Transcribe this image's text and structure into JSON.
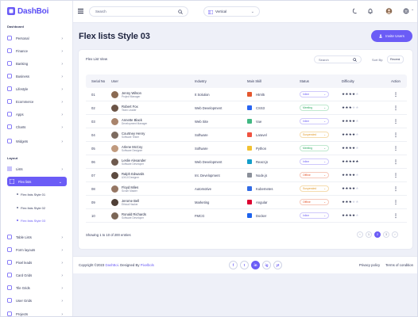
{
  "brand": {
    "name": "DashBoi",
    "accent": "#6b5cf6"
  },
  "topbar": {
    "search_placeholder": "Search",
    "layout_value": "Vertical"
  },
  "sidebar": {
    "section_dashboard": "Dashboard",
    "dashboard_items": [
      {
        "label": "Personal",
        "icon": "user-icon"
      },
      {
        "label": "Finance",
        "icon": "wallet-icon"
      },
      {
        "label": "Banking",
        "icon": "bank-icon"
      },
      {
        "label": "Business",
        "icon": "briefcase-icon"
      },
      {
        "label": "Lifestyle",
        "icon": "heart-icon"
      },
      {
        "label": "Ecommerce",
        "icon": "cart-icon"
      },
      {
        "label": "Apps",
        "icon": "grid-icon"
      },
      {
        "label": "Charts",
        "icon": "chart-icon"
      },
      {
        "label": "Widgets",
        "icon": "widget-icon"
      }
    ],
    "section_layout": "Layout",
    "layout_items": [
      {
        "label": "Lists"
      },
      {
        "label": "Flex lists"
      }
    ],
    "sub_items": [
      {
        "label": "Flex lists Style 01"
      },
      {
        "label": "Flex lists Style 02"
      },
      {
        "label": "Flex lists Style 03"
      }
    ],
    "more_items": [
      {
        "label": "Table Lists"
      },
      {
        "label": "Form layouts"
      },
      {
        "label": "Pixel leads"
      },
      {
        "label": "Card Grids"
      },
      {
        "label": "Tile Grids"
      },
      {
        "label": "User Grids"
      },
      {
        "label": "Projects"
      }
    ]
  },
  "page": {
    "title": "Flex lists Style 03",
    "invite_label": "Invite Users"
  },
  "card": {
    "title": "Flex List View",
    "search_placeholder": "Search",
    "sort_label": "Sort By:",
    "sort_value": "Recent"
  },
  "table": {
    "headers": [
      "Serial No",
      "User",
      "Industry",
      "Main Skill",
      "Status",
      "Difficulty",
      "Action"
    ],
    "rows": [
      {
        "sn": "01",
        "name": "Jenny Wilson",
        "role": "Project Manager",
        "industry": "It Solution",
        "skill": "Html5",
        "skill_color": "#e4572e",
        "status": "Inline",
        "diff": 4,
        "avatar": "#8a6a52"
      },
      {
        "sn": "02",
        "name": "Robert Fox",
        "role": "Team Leader",
        "industry": "Web Development",
        "skill": "CSS3",
        "skill_color": "#2965f1",
        "status": "Meeting",
        "diff": 3,
        "avatar": "#6b5446"
      },
      {
        "sn": "03",
        "name": "Annette Black",
        "role": "Development Manager",
        "industry": "Web Site",
        "skill": "Vue",
        "skill_color": "#41b883",
        "status": "Inline",
        "diff": 4,
        "avatar": "#a8836b"
      },
      {
        "sn": "04",
        "name": "Courtney Henry",
        "role": "Software Tester",
        "industry": "Software",
        "skill": "Laravel",
        "skill_color": "#f05340",
        "status": "Suspended",
        "diff": 4,
        "avatar": "#7d6b5f"
      },
      {
        "sn": "05",
        "name": "Arlene McCoy",
        "role": "Software Designer",
        "industry": "Software",
        "skill": "Python",
        "skill_color": "#f2c232",
        "status": "Meeting",
        "diff": 4,
        "avatar": "#c09a7e"
      },
      {
        "sn": "06",
        "name": "Leslie Alexander",
        "role": "Software Developer",
        "industry": "Web Development",
        "skill": "React.js",
        "skill_color": "#149eca",
        "status": "Inline",
        "diff": 5,
        "avatar": "#6e5a4e"
      },
      {
        "sn": "07",
        "name": "Ralph Edwards",
        "role": "UX/UI Designer",
        "industry": "Int. Development",
        "skill": "Node.js",
        "skill_color": "#8a8f99",
        "status": "Offline",
        "diff": 4,
        "avatar": "#5c4a3f"
      },
      {
        "sn": "08",
        "name": "Floyd Miles",
        "role": "Scrum Master",
        "industry": "Automotive",
        "skill": "Kubernetes",
        "skill_color": "#326ce5",
        "status": "Suspended",
        "diff": 4,
        "avatar": "#957663"
      },
      {
        "sn": "09",
        "name": "Jerome Bell",
        "role": "Ethical Hacker",
        "industry": "Marketing",
        "skill": "Angular",
        "skill_color": "#dd0031",
        "status": "Offline",
        "diff": 3,
        "avatar": "#4f3f36"
      },
      {
        "sn": "10",
        "name": "Ronald Richards",
        "role": "Software Developer",
        "industry": "FMCG",
        "skill": "Docker",
        "skill_color": "#1d63ed",
        "status": "Inline",
        "diff": 4,
        "avatar": "#7b6656"
      }
    ],
    "status_colors": {
      "Inline": {
        "fg": "#6b5cf6",
        "border": "#cfc9fb"
      },
      "Meeting": {
        "fg": "#2eaa62",
        "border": "#bfe8cf"
      },
      "Suspended": {
        "fg": "#e09a2b",
        "border": "#f5dcae"
      },
      "Offline": {
        "fg": "#e4572e",
        "border": "#f6c9bb"
      }
    },
    "showing_text": "Showing 1 to 10 of 200 entries",
    "pages": [
      "‹",
      "1",
      "2",
      "3",
      "›"
    ],
    "current_page": "2"
  },
  "footer": {
    "copyright_prefix": "Copyright ©2023 ",
    "copyright_brand": "DashBoi",
    "copyright_mid": ". Designed By ",
    "copyright_designer": "Pixelbols",
    "social_icons": [
      "f",
      "t",
      "in",
      "ig",
      "yt"
    ],
    "links": [
      "Privacy policy",
      "Terms of condition"
    ]
  }
}
